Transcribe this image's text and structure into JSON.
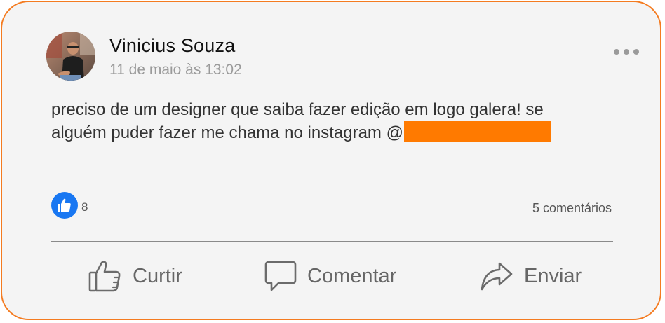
{
  "post": {
    "author": "Vinicius Souza",
    "timestamp": "11 de maio às 13:02",
    "text_line1": "preciso de um designer que saiba fazer edição em logo galera! se",
    "text_line2": "alguém puder fazer me chama no instagram @",
    "redaction_color": "#ff7a00"
  },
  "reactions": {
    "like_count": "8",
    "comments_count": "5 comentários"
  },
  "actions": {
    "like_label": "Curtir",
    "comment_label": "Comentar",
    "share_label": "Enviar"
  },
  "icons": {
    "menu": "more-dots-icon",
    "like_badge": "thumbs-up-icon",
    "like": "thumbs-up-outline-icon",
    "comment": "speech-bubble-icon",
    "share": "share-arrow-icon"
  },
  "colors": {
    "card_border": "#f47b20",
    "card_bg": "#f4f4f4",
    "like_blue": "#1877f2"
  }
}
